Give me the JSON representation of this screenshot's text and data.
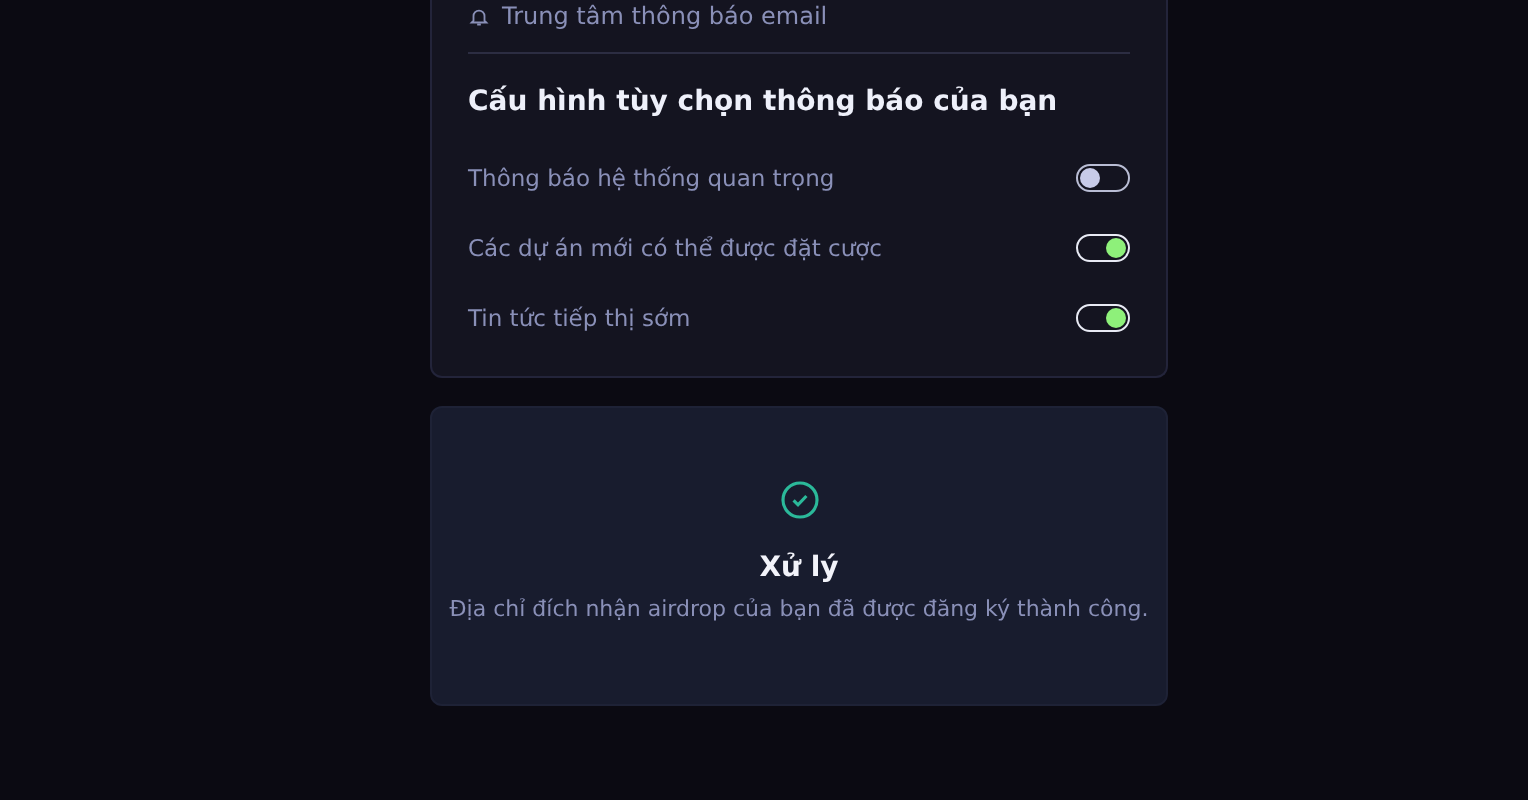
{
  "email_link": {
    "label": "Trung tâm thông báo email"
  },
  "preferences": {
    "heading": "Cấu hình tùy chọn thông báo của bạn",
    "items": [
      {
        "label": "Thông báo hệ thống quan trọng",
        "on": false
      },
      {
        "label": "Các dự án mới có thể được đặt cược",
        "on": true
      },
      {
        "label": "Tin tức tiếp thị sớm",
        "on": true
      }
    ]
  },
  "status": {
    "title": "Xử lý",
    "message": "Địa chỉ đích nhận airdrop của bạn đã được đăng ký thành công."
  }
}
